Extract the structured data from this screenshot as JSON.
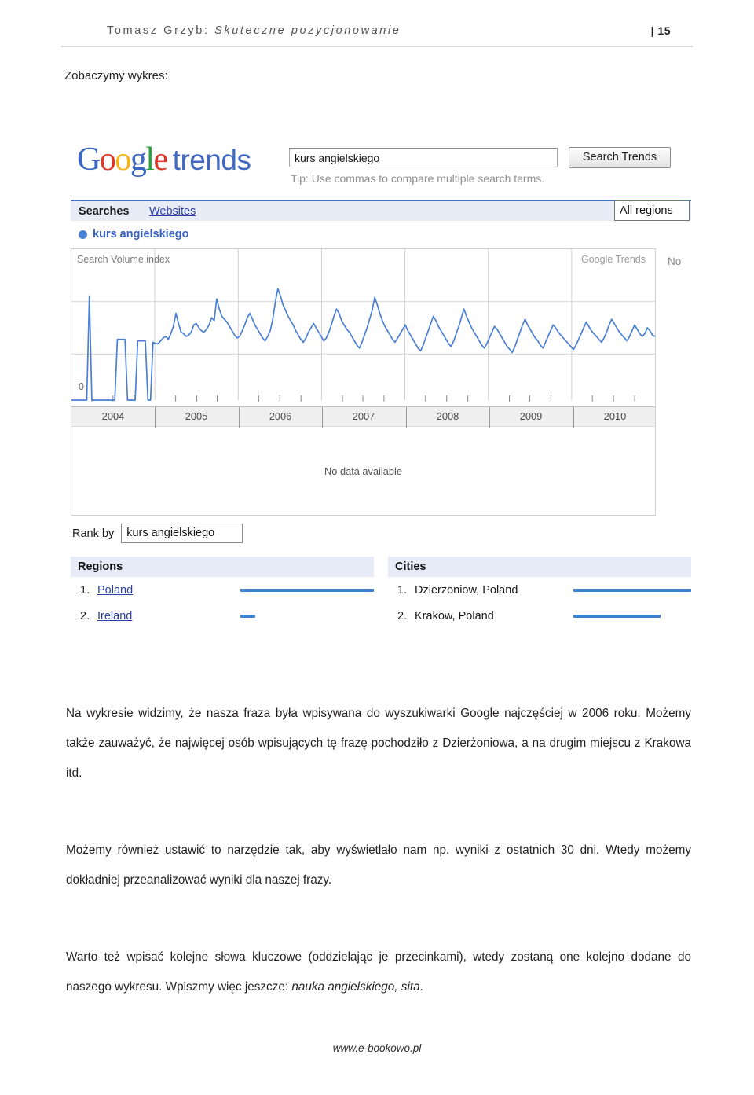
{
  "header": {
    "author": "Tomasz Grzyb:",
    "title": "Skuteczne pozycjonowanie",
    "page_number": "| 15"
  },
  "intro": {
    "text": "Zobaczymy wykres:"
  },
  "google_trends": {
    "logo": {
      "g1": "G",
      "o1": "o",
      "o2": "o",
      "g2": "g",
      "l1": "l",
      "e1": "e",
      "wordmark": "trends"
    },
    "search_input_value": "kurs angielskiego",
    "search_button_label": "Search Trends",
    "tip_text": "Tip: Use commas to compare multiple search terms.",
    "tabs": [
      {
        "label": "Searches",
        "active": true
      },
      {
        "label": "Websites",
        "active": false
      }
    ],
    "region_filter_value": "All regions",
    "series_legend_label": "kurs angielskiego",
    "chart_panel": {
      "y_axis_label": "Search Volume index",
      "watermark": "Google Trends",
      "zero_label": "0",
      "no_data_text": "No data available",
      "cut_off_text": "No"
    },
    "rank_by": {
      "label": "Rank by",
      "selected_value": "kurs angielskiego"
    },
    "regions": {
      "heading": "Regions",
      "rows": [
        {
          "rank": "1.",
          "name": "Poland",
          "bar_pct": 100
        },
        {
          "rank": "2.",
          "name": "Ireland",
          "bar_pct": 11
        }
      ]
    },
    "cities": {
      "heading": "Cities",
      "rows": [
        {
          "rank": "1.",
          "name": "Dzierzoniow, Poland",
          "bar_pct": 100
        },
        {
          "rank": "2.",
          "name": "Krakow, Poland",
          "bar_pct": 74
        }
      ]
    },
    "colors": {
      "series_blue": "#4a7fd4",
      "link_blue": "#2a3fa8",
      "tab_bg": "#e7ecf7",
      "bar_blue": "#3f7fd0"
    }
  },
  "chart_data": {
    "type": "line",
    "title": "kurs angielskiego",
    "xlabel": "",
    "ylabel": "Search Volume index",
    "legend": [
      "kurs angielskiego"
    ],
    "legend_position": "top-left",
    "grid": true,
    "watermark": "Google Trends",
    "x_tick_labels": [
      "2004",
      "2005",
      "2006",
      "2007",
      "2008",
      "2009",
      "2010"
    ],
    "y_tick_labels": [
      "0"
    ],
    "xlim": [
      2004.0,
      2010.75
    ],
    "ylim": [
      0,
      100
    ],
    "gridlines_y": [
      33,
      66
    ],
    "series": [
      {
        "name": "kurs angielskiego",
        "values": [
          0,
          0,
          0,
          0,
          0,
          0,
          0,
          72,
          0,
          0,
          0,
          0,
          0,
          0,
          0,
          0,
          0,
          0,
          42,
          42,
          42,
          42,
          0,
          0,
          0,
          0,
          41,
          41,
          41,
          41,
          0,
          0,
          40,
          39,
          39,
          41,
          43,
          44,
          42,
          46,
          51,
          60,
          53,
          47,
          46,
          44,
          45,
          47,
          52,
          53,
          50,
          48,
          47,
          49,
          52,
          57,
          55,
          70,
          63,
          58,
          56,
          54,
          51,
          48,
          45,
          43,
          44,
          48,
          52,
          57,
          60,
          56,
          52,
          49,
          46,
          43,
          41,
          44,
          48,
          56,
          68,
          77,
          72,
          66,
          62,
          58,
          55,
          52,
          48,
          45,
          42,
          40,
          43,
          47,
          50,
          53,
          50,
          47,
          44,
          41,
          43,
          47,
          52,
          58,
          63,
          60,
          55,
          52,
          49,
          47,
          44,
          41,
          38,
          36,
          40,
          45,
          50,
          56,
          62,
          71,
          66,
          60,
          55,
          51,
          48,
          45,
          42,
          40,
          43,
          46,
          49,
          52,
          48,
          45,
          42,
          39,
          36,
          34,
          38,
          43,
          48,
          53,
          58,
          55,
          51,
          48,
          45,
          42,
          39,
          37,
          41,
          46,
          51,
          57,
          63,
          58,
          54,
          50,
          47,
          44,
          41,
          38,
          36,
          39,
          43,
          47,
          51,
          49,
          46,
          43,
          40,
          37,
          35,
          33,
          37,
          42,
          47,
          52,
          56,
          52,
          49,
          46,
          43,
          41,
          38,
          36,
          40,
          44,
          48,
          52,
          50,
          47,
          45,
          43,
          41,
          39,
          37,
          35,
          38,
          42,
          46,
          50,
          54,
          51,
          48,
          46,
          44,
          42,
          40,
          43,
          47,
          52,
          56,
          53,
          50,
          47,
          45,
          43,
          41,
          44,
          48,
          52,
          49,
          46,
          44,
          46,
          50,
          48,
          45,
          44
        ]
      }
    ]
  },
  "paragraphs": {
    "p1": "Na wykresie widzimy, że nasza fraza była wpisywana do wyszukiwarki Google najczęściej w 2006 roku. Możemy także zauważyć, że najwięcej osób wpisujących tę frazę pochodziło z Dzierżoniowa, a na drugim miejscu z Krakowa itd.",
    "p2": "Możemy również ustawić to narzędzie tak, aby wyświetlało nam np. wyniki z ostatnich 30 dni. Wtedy możemy dokładniej przeanalizować wyniki dla naszej frazy.",
    "p3_lead": "Warto też wpisać kolejne słowa kluczowe (oddzielając je przecinkami), wtedy zostaną one kolejno dodane do naszego wykresu. Wpiszmy więc jeszcze: ",
    "p3_italic": "nauka angielskiego, sita",
    "p3_tail": "."
  },
  "footer": {
    "text": "www.e-bookowo.pl"
  }
}
